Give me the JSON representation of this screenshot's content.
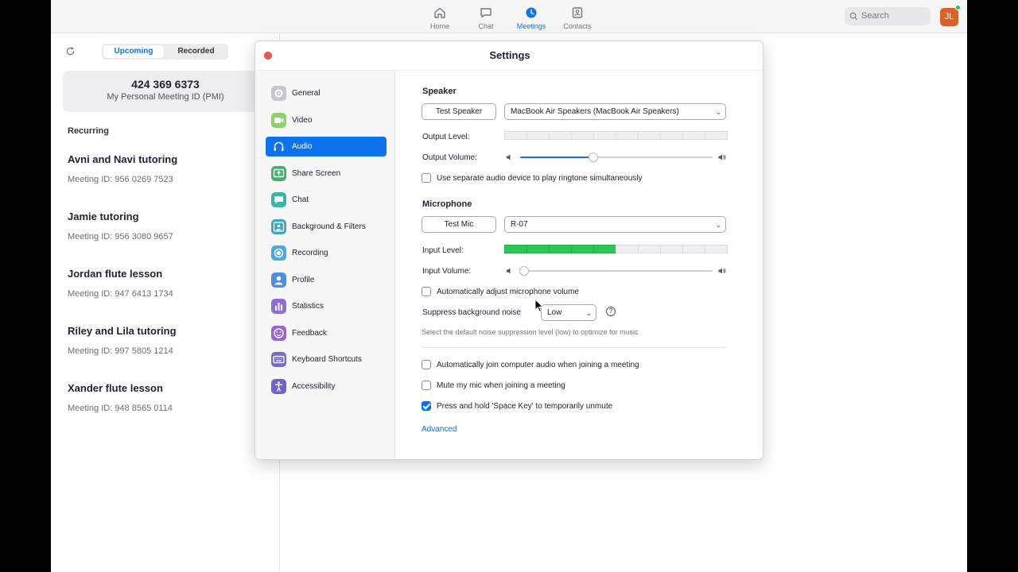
{
  "nav": {
    "items": [
      {
        "label": "Home",
        "icon": "home-icon"
      },
      {
        "label": "Chat",
        "icon": "chat-icon"
      },
      {
        "label": "Meetings",
        "icon": "clock-icon",
        "active": true
      },
      {
        "label": "Contacts",
        "icon": "contacts-icon"
      }
    ],
    "search_placeholder": "Search",
    "avatar_initials": "JL",
    "accent": "#0e72ed"
  },
  "meetings_panel": {
    "tabs": [
      "Upcoming",
      "Recorded"
    ],
    "active_tab": "Upcoming",
    "pmi_number": "424 369 6373",
    "pmi_label": "My Personal Meeting ID (PMI)",
    "section": "Recurring",
    "meetings": [
      {
        "title": "Avni and Navi tutoring",
        "id": "Meeting ID: 956 0269 7523"
      },
      {
        "title": "Jamie tutoring",
        "id": "Meeting ID: 956 3080 9657"
      },
      {
        "title": "Jordan flute lesson",
        "id": "Meeting ID: 947 6413 1734"
      },
      {
        "title": "Riley and Lila tutoring",
        "id": "Meeting ID: 997 5805 1214"
      },
      {
        "title": "Xander flute lesson",
        "id": "Meeting ID: 948 8565 0114"
      }
    ]
  },
  "settings": {
    "title": "Settings",
    "sidebar": [
      {
        "label": "General",
        "icon": "gear-icon",
        "color": "#c7c7cc"
      },
      {
        "label": "Video",
        "icon": "video-icon",
        "color": "#8fd16a"
      },
      {
        "label": "Audio",
        "icon": "headphones-icon",
        "color": "#0e72ed",
        "active": true
      },
      {
        "label": "Share Screen",
        "icon": "share-screen-icon",
        "color": "#3db36b"
      },
      {
        "label": "Chat",
        "icon": "chat-bubble-icon",
        "color": "#3cb5a8"
      },
      {
        "label": "Background & Filters",
        "icon": "person-frame-icon",
        "color": "#3aa6c9"
      },
      {
        "label": "Recording",
        "icon": "record-icon",
        "color": "#48a9e8"
      },
      {
        "label": "Profile",
        "icon": "profile-icon",
        "color": "#4b90e6"
      },
      {
        "label": "Statistics",
        "icon": "stats-icon",
        "color": "#8b6fd6"
      },
      {
        "label": "Feedback",
        "icon": "smiley-icon",
        "color": "#9a62d8"
      },
      {
        "label": "Keyboard Shortcuts",
        "icon": "keyboard-icon",
        "color": "#7b69d3"
      },
      {
        "label": "Accessibility",
        "icon": "accessibility-icon",
        "color": "#6f62cf"
      }
    ],
    "audio": {
      "speaker_heading": "Speaker",
      "test_speaker": "Test Speaker",
      "speaker_device": "MacBook Air Speakers (MacBook Air Speakers)",
      "output_level_label": "Output Level:",
      "output_level_segments": 0,
      "output_volume_label": "Output Volume:",
      "output_volume": 0.38,
      "separate_device_label": "Use separate audio device to play ringtone simultaneously",
      "separate_device_checked": false,
      "mic_heading": "Microphone",
      "test_mic": "Test Mic",
      "mic_device": "R-07",
      "input_level_label": "Input Level:",
      "input_level_segments": 5,
      "input_volume_label": "Input Volume:",
      "input_volume": 0.02,
      "auto_adjust_label": "Automatically adjust microphone volume",
      "auto_adjust_checked": false,
      "suppress_label": "Suppress background noise",
      "suppress_value": "Low",
      "suppress_hint": "Select the default noise suppression level (low) to optimize for music",
      "help_glyph": "?",
      "auto_join_label": "Automatically join computer audio when joining a meeting",
      "auto_join_checked": false,
      "mute_label": "Mute my mic when joining a meeting",
      "mute_checked": false,
      "space_label": "Press and hold 'Space Key' to temporarily unmute",
      "space_checked": true,
      "advanced": "Advanced"
    }
  }
}
